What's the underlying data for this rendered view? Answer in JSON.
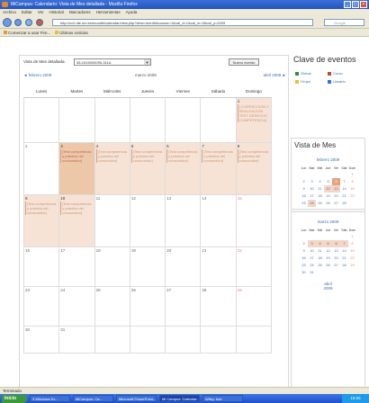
{
  "window": {
    "title": "MiCampus: Calendario: Vista de Mes detallada - Mozilla Firefox"
  },
  "menu": [
    "Archivo",
    "Editar",
    "Ver",
    "Historial",
    "Marcadores",
    "Herramientas",
    "Ayuda"
  ],
  "url": "http://cv2.dte.um.es/moodle/calendar/view.php?view=month&course=1&cal_d=1&cal_m=3&cal_y=2009",
  "search_placeholder": "Google",
  "bookmarks": [
    "Comenzar a usar Fire...",
    "Últimas noticias"
  ],
  "calendar": {
    "header_label": "Vista de Mes detallada:",
    "course_select": "08-1515000095-311A",
    "new_event": "Nuevo evento",
    "prev_month": "◄ febrero 2009",
    "current_month": "marzo 2009",
    "next_month": "abril 2009 ►",
    "weekdays": [
      "Lunes",
      "Martes",
      "Miércoles",
      "Jueves",
      "Viernes",
      "Sábado",
      "Domingo"
    ],
    "event_first": "[ CORRECCIÓN Y REALIZACIÓN TEST DERECHO COMPETENCIA]",
    "event_text": "[Test competencia y práctica del consumidor]",
    "event_text_short": "[Test competencia y práctica del consumidor]"
  },
  "sidebar": {
    "key_title": "Clave de eventos",
    "legend": [
      {
        "label": "Global",
        "color": "#3c8a3c"
      },
      {
        "label": "Curso",
        "color": "#c84a2a"
      },
      {
        "label": "Grupo",
        "color": "#e8c030"
      },
      {
        "label": "Usuario",
        "color": "#3c6fd8"
      }
    ],
    "vista_title": "Vista de Mes",
    "mini_headers": [
      "Lun",
      "Mar",
      "Mié",
      "Jue",
      "Vie",
      "Sáb",
      "Dom"
    ],
    "mini1_caption": "febrero 2009",
    "mini2_caption": "marzo 2009",
    "mini3_caption": "abril 2009"
  },
  "status": "Terminado",
  "taskbar": {
    "start": "Inicio",
    "tasks": [
      "3 Windows Ex...",
      "MiCampus: Ca...",
      "Microsoft PowerPoint...",
      "Mi Campus: Calendar...",
      "Wiley: test"
    ],
    "clock": "16:55"
  }
}
